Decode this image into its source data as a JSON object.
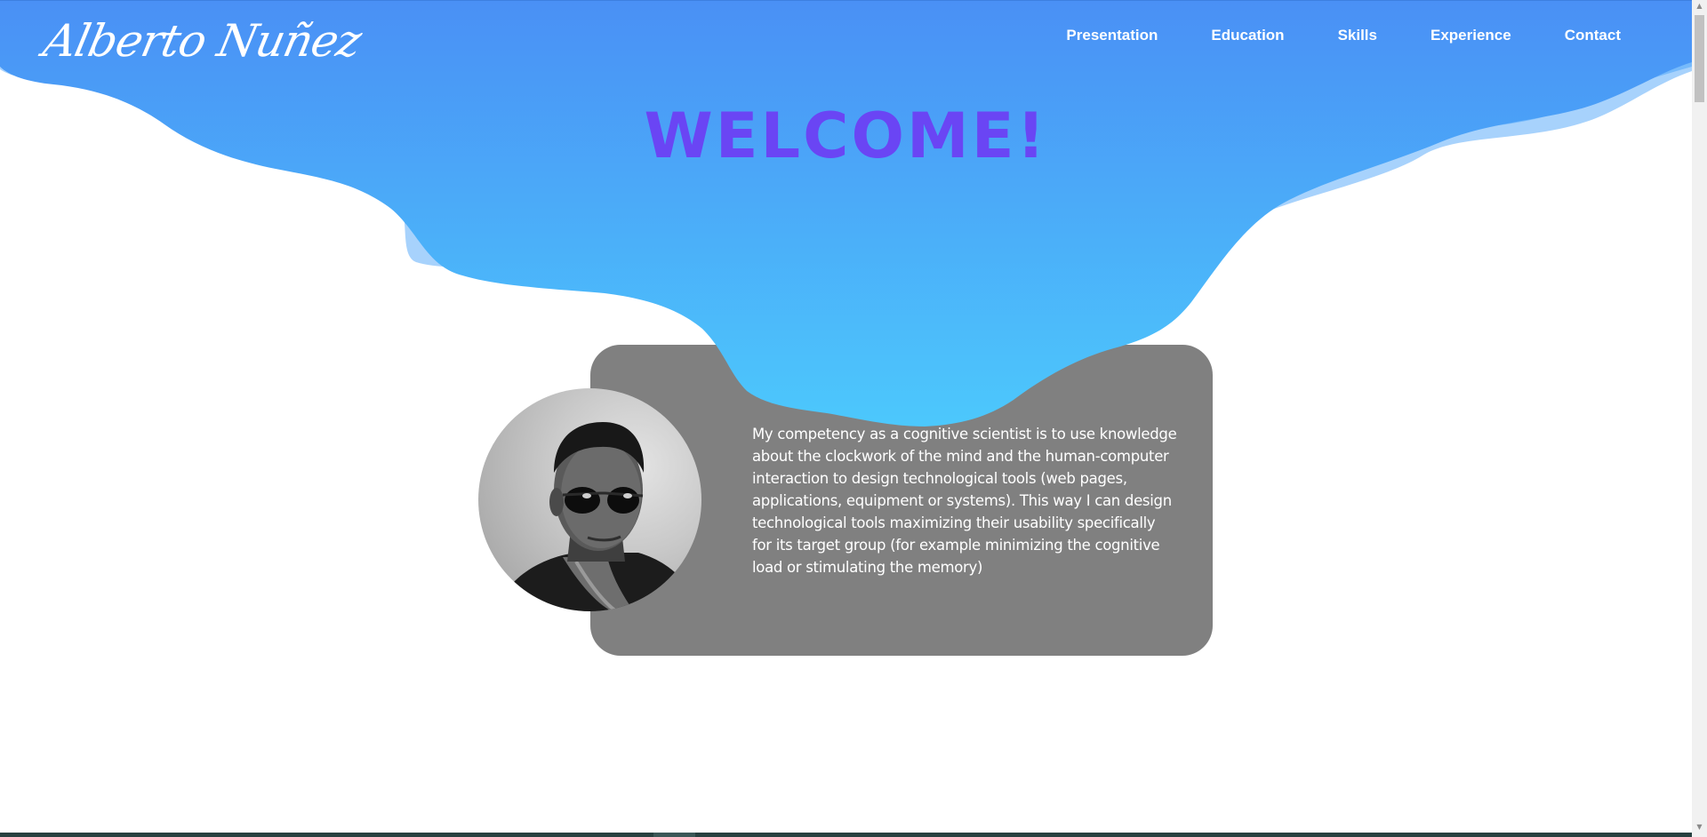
{
  "header": {
    "logo_text": "Alberto Nuñez",
    "nav": [
      {
        "label": "Presentation"
      },
      {
        "label": "Education"
      },
      {
        "label": "Skills"
      },
      {
        "label": "Experience"
      },
      {
        "label": "Contact"
      }
    ]
  },
  "hero": {
    "title": "WELCOME!"
  },
  "presentation": {
    "text": "My competency as a cognitive scientist is to use knowledge about the clockwork of the mind and the human-computer interaction to design technological tools (web pages, applications, equipment or systems). This way I can design technological tools maximizing their usability specifically for its target group (for example minimizing the cognitive load or stimulating the memory)"
  },
  "colors": {
    "wave_top": "#4a90f5",
    "wave_bottom": "#4cc8fc",
    "title": "#6a45f4",
    "card": "#808080"
  },
  "icons": {
    "scroll_up": "triangle-up-icon",
    "scroll_down": "triangle-down-icon"
  }
}
